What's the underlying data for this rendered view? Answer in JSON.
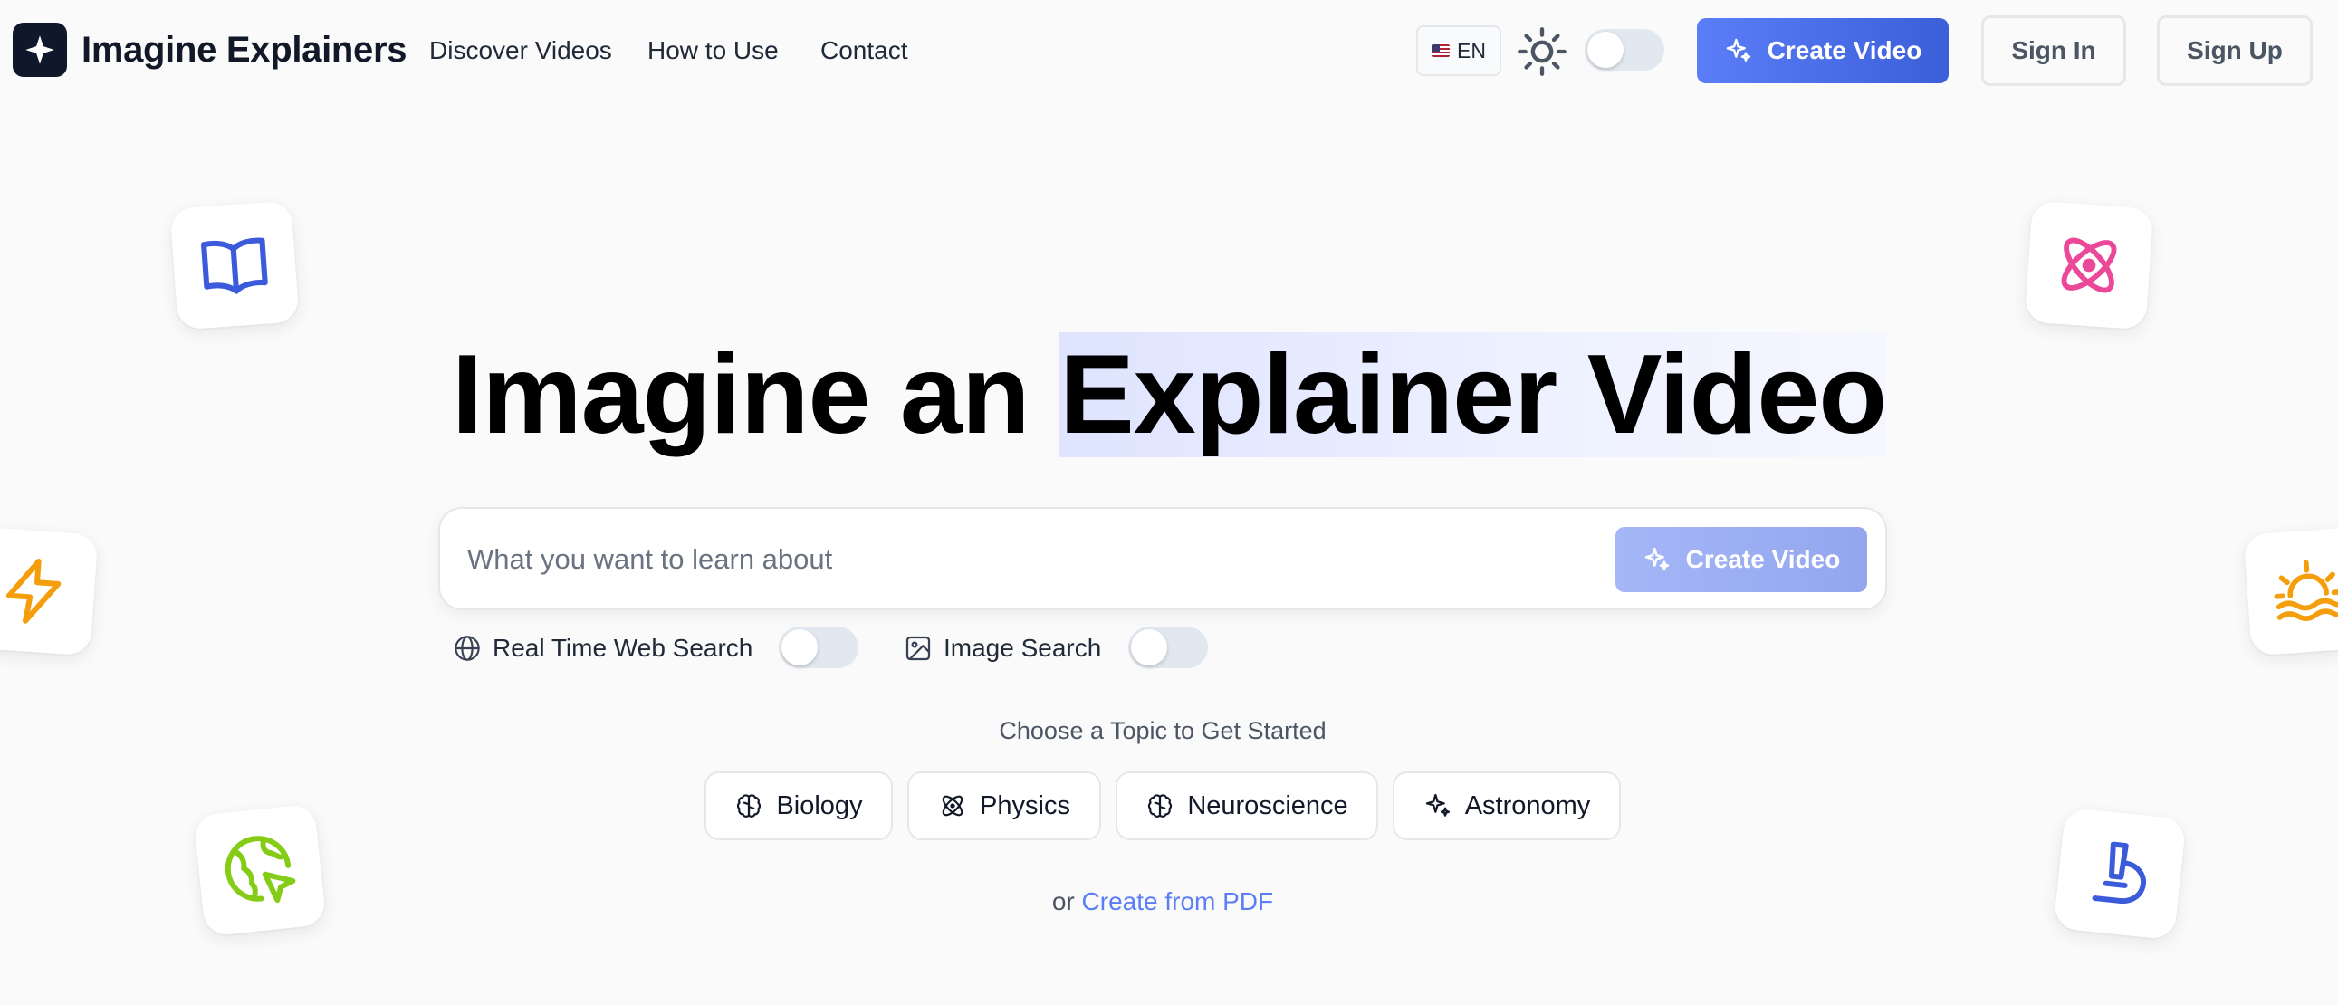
{
  "header": {
    "brand": "Imagine Explainers",
    "nav_links": [
      "Discover Videos",
      "How to Use",
      "Contact"
    ],
    "language": {
      "flag": "us-flag-icon",
      "code": "EN"
    },
    "theme_icon": "sun-icon",
    "theme_dark_mode": false,
    "create_video_label": "Create Video",
    "sign_in_label": "Sign In",
    "sign_up_label": "Sign Up"
  },
  "hero": {
    "headline_prefix": "Imagine an ",
    "headline_highlight": "Explainer Video"
  },
  "search": {
    "value": "",
    "placeholder": "What you want to learn about",
    "create_video_label": "Create Video",
    "options": [
      {
        "label": "Real Time Web Search",
        "icon": "globe-icon",
        "enabled": false
      },
      {
        "label": "Image Search",
        "icon": "image-icon",
        "enabled": false
      }
    ]
  },
  "topics": {
    "heading": "Choose a Topic to Get Started",
    "items": [
      {
        "label": "Biology",
        "icon": "brain-icon"
      },
      {
        "label": "Physics",
        "icon": "atom-icon"
      },
      {
        "label": "Neuroscience",
        "icon": "brain-icon"
      },
      {
        "label": "Astronomy",
        "icon": "sparkles-icon"
      }
    ]
  },
  "pdf": {
    "prefix": "or",
    "link_label": "Create from PDF"
  },
  "decor_icons": [
    {
      "name": "book-icon",
      "color": "#3b5bdb"
    },
    {
      "name": "atom-icon",
      "color": "#ec4899"
    },
    {
      "name": "lightning-icon",
      "color": "#f59e0b"
    },
    {
      "name": "sunrise-icon",
      "color": "#f59e0b"
    },
    {
      "name": "globe-cursor-icon",
      "color": "#84cc16"
    },
    {
      "name": "microscope-icon",
      "color": "#3b5bdb"
    }
  ],
  "colors": {
    "accent": "#5b7ef8",
    "accent_dark": "#3b5fd8",
    "highlight": "#e4e8ff",
    "background": "#fafafa"
  }
}
